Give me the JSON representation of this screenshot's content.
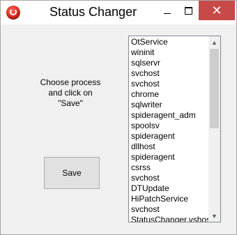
{
  "window": {
    "title": "Status Changer",
    "icon": "app-logo-icon",
    "controls": {
      "minimize": "minimize-icon",
      "maximize": "maximize-icon",
      "close": "✕"
    }
  },
  "instruction": "Choose process\nand click on\n\"Save\"",
  "save_button": {
    "label": "Save"
  },
  "process_list": {
    "items": [
      "OtService",
      "wininit",
      "sqlservr",
      "svchost",
      "svchost",
      "chrome",
      "sqlwriter",
      "spideragent_adm",
      "spoolsv",
      "spideragent",
      "dllhost",
      "spideragent",
      "csrss",
      "svchost",
      "DTUpdate",
      "HiPatchService",
      "svchost",
      "StatusChanger.vshost"
    ],
    "scroll_position": 0
  },
  "colors": {
    "close_button": "#c74a49",
    "window_background": "#f0f0f0",
    "titlebar": "#ffffff"
  }
}
